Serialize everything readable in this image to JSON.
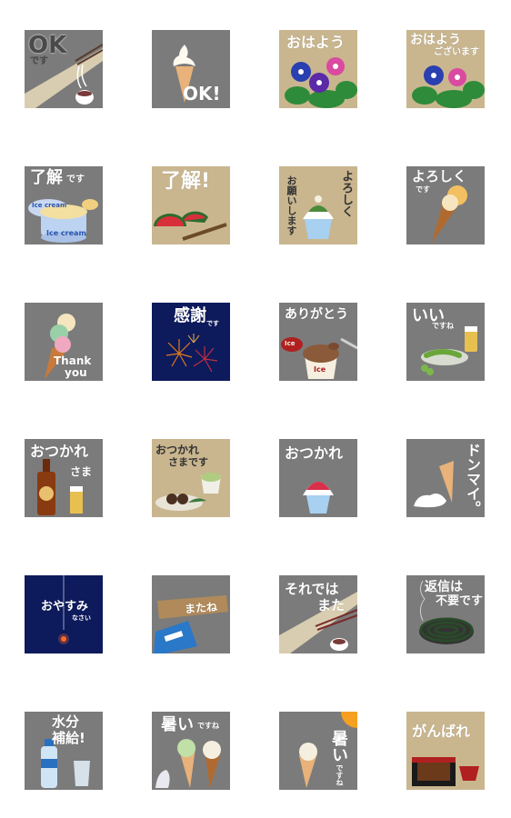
{
  "colors": {
    "gray": "#7b7b7b",
    "beige": "#c9b68f",
    "navy": "#0d1a5c"
  },
  "stickers": [
    {
      "id": "r1c1",
      "bg": "gray",
      "texts": [
        "OK",
        "です"
      ]
    },
    {
      "id": "r1c2",
      "bg": "gray",
      "texts": [
        "OK!"
      ]
    },
    {
      "id": "r1c3",
      "bg": "beige",
      "texts": [
        "おはよう"
      ]
    },
    {
      "id": "r1c4",
      "bg": "beige",
      "texts": [
        "おはよう",
        "ございます"
      ]
    },
    {
      "id": "r2c1",
      "bg": "gray",
      "texts": [
        "了解",
        "です",
        "Ice cream",
        "Ice cream"
      ]
    },
    {
      "id": "r2c2",
      "bg": "beige",
      "texts": [
        "了解!"
      ]
    },
    {
      "id": "r2c3",
      "bg": "beige",
      "texts": [
        "よろしく",
        "お願いします"
      ]
    },
    {
      "id": "r2c4",
      "bg": "gray",
      "texts": [
        "よろしく",
        "です"
      ]
    },
    {
      "id": "r3c1",
      "bg": "gray",
      "texts": [
        "Thank",
        "you"
      ]
    },
    {
      "id": "r3c2",
      "bg": "navy",
      "texts": [
        "感謝",
        "です"
      ]
    },
    {
      "id": "r3c3",
      "bg": "gray",
      "texts": [
        "ありがとう",
        "Ice",
        "Ice"
      ]
    },
    {
      "id": "r3c4",
      "bg": "gray",
      "texts": [
        "いい",
        "ですね"
      ]
    },
    {
      "id": "r4c1",
      "bg": "gray",
      "texts": [
        "おつかれ",
        "さま"
      ]
    },
    {
      "id": "r4c2",
      "bg": "beige",
      "texts": [
        "おつかれ",
        "さまです"
      ]
    },
    {
      "id": "r4c3",
      "bg": "gray",
      "texts": [
        "おつかれ"
      ]
    },
    {
      "id": "r4c4",
      "bg": "gray",
      "texts": [
        "ドンマイ。"
      ]
    },
    {
      "id": "r5c1",
      "bg": "navy",
      "texts": [
        "おやすみ",
        "なさい"
      ]
    },
    {
      "id": "r5c2",
      "bg": "gray",
      "texts": [
        "またね"
      ]
    },
    {
      "id": "r5c3",
      "bg": "gray",
      "texts": [
        "それでは",
        "また"
      ]
    },
    {
      "id": "r5c4",
      "bg": "gray",
      "texts": [
        "返信は",
        "不要です"
      ]
    },
    {
      "id": "r6c1",
      "bg": "gray",
      "texts": [
        "水分",
        "補給!"
      ]
    },
    {
      "id": "r6c2",
      "bg": "gray",
      "texts": [
        "暑い",
        "ですね"
      ]
    },
    {
      "id": "r6c3",
      "bg": "gray",
      "texts": [
        "暑い",
        "ですね"
      ]
    },
    {
      "id": "r6c4",
      "bg": "beige",
      "texts": [
        "がんばれ"
      ]
    }
  ]
}
